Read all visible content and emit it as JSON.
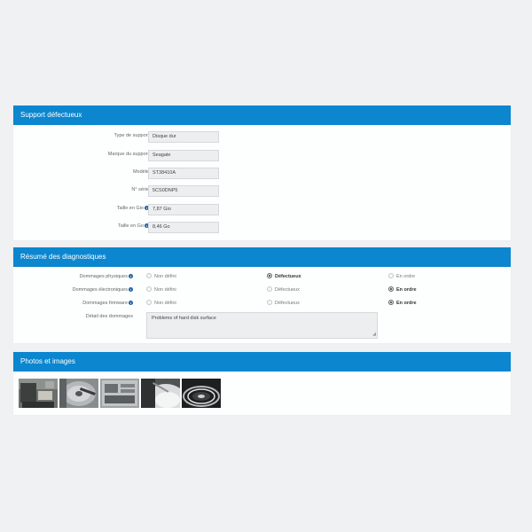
{
  "support": {
    "title": "Support défectueux",
    "fields": [
      {
        "label": "Type de support",
        "value": "Disque dur",
        "info": false
      },
      {
        "label": "Marque du support",
        "value": "Seagate",
        "info": false
      },
      {
        "label": "Modèle",
        "value": "ST38410A",
        "info": false
      },
      {
        "label": "N° série",
        "value": "5CS0DNP5",
        "info": false
      },
      {
        "label": "Taille en Gio",
        "value": "7,87 Gio",
        "info": true
      },
      {
        "label": "Taille en Go",
        "value": "8,46 Go",
        "info": true
      }
    ]
  },
  "diagnostics": {
    "title": "Résumé des diagnostiques",
    "rows": [
      {
        "label": "Dommages physiques",
        "options": [
          "Non défini",
          "Défectueux",
          "En ordre"
        ],
        "selected": 1
      },
      {
        "label": "Dommages électroniques",
        "options": [
          "Non défini",
          "Défectueux",
          "En ordre"
        ],
        "selected": 2
      },
      {
        "label": "Dommages firmware",
        "options": [
          "Non défini",
          "Défectueux",
          "En ordre"
        ],
        "selected": 2
      }
    ],
    "detail_label": "Détail des dommages",
    "detail_value": "Problems of hard disk surface"
  },
  "photos": {
    "title": "Photos et images",
    "images": [
      "photo-1",
      "photo-2",
      "photo-3",
      "photo-4",
      "photo-5"
    ]
  },
  "colors": {
    "header_bg": "#0b86cf",
    "page_bg": "#f0f1f3"
  }
}
